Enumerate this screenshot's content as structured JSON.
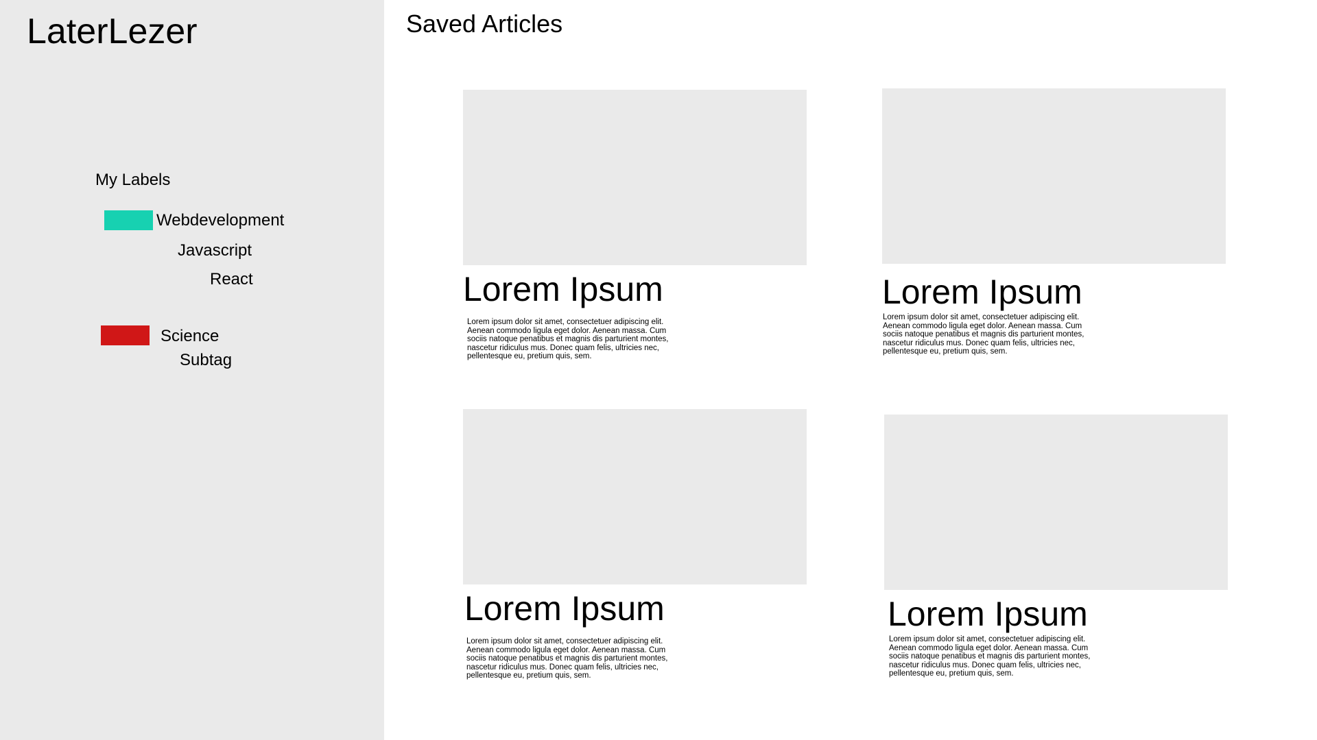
{
  "app": {
    "title": "LaterLezer"
  },
  "sidebar": {
    "labels_heading": "My Labels",
    "labels": [
      {
        "label": "Webdevelopment",
        "color": "#17d1b1"
      },
      {
        "label": "Javascript"
      },
      {
        "label": "React"
      },
      {
        "label": "Science",
        "color": "#d01717"
      },
      {
        "label": "Subtag"
      }
    ]
  },
  "main": {
    "title": "Saved Articles",
    "articles": [
      {
        "title": "Lorem Ipsum",
        "excerpt": "Lorem ipsum dolor sit amet, consectetuer adipiscing elit. Aenean commodo ligula eget dolor. Aenean massa. Cum sociis natoque penatibus et magnis dis parturient montes, nascetur ridiculus mus. Donec quam felis, ultricies nec, pellentesque eu, pretium quis, sem."
      },
      {
        "title": "Lorem Ipsum",
        "excerpt": "Lorem ipsum dolor sit amet, consectetuer adipiscing elit. Aenean commodo ligula eget dolor. Aenean massa. Cum sociis natoque penatibus et magnis dis parturient montes, nascetur ridiculus mus. Donec quam felis, ultricies nec, pellentesque eu, pretium quis, sem."
      },
      {
        "title": "Lorem Ipsum",
        "excerpt": "Lorem ipsum dolor sit amet, consectetuer adipiscing elit. Aenean commodo ligula eget dolor. Aenean massa. Cum sociis natoque penatibus et magnis dis parturient montes, nascetur ridiculus mus. Donec quam felis, ultricies nec, pellentesque eu, pretium quis, sem."
      },
      {
        "title": "Lorem Ipsum",
        "excerpt": "Lorem ipsum dolor sit amet, consectetuer adipiscing elit. Aenean commodo ligula eget dolor. Aenean massa. Cum sociis natoque penatibus et magnis dis parturient montes, nascetur ridiculus mus. Donec quam felis, ultricies nec, pellentesque eu, pretium quis, sem."
      }
    ]
  }
}
